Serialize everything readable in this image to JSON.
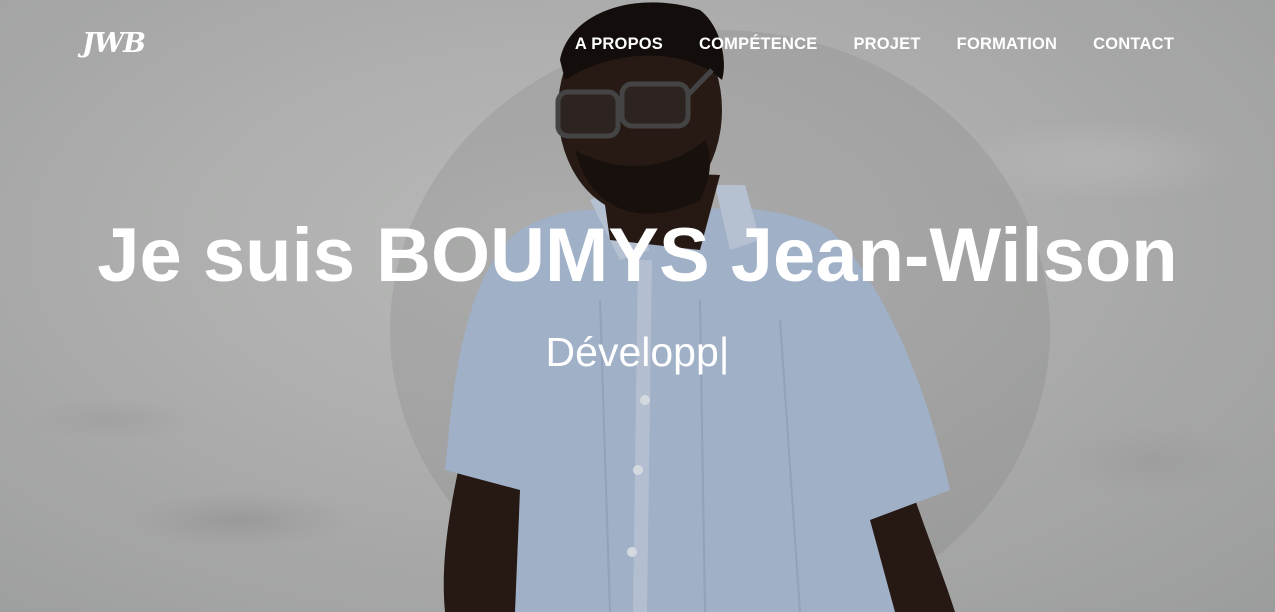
{
  "brand": {
    "logo_text": "JWB"
  },
  "nav": {
    "items": [
      {
        "label": "A PROPOS"
      },
      {
        "label": "COMPÉTENCE"
      },
      {
        "label": "PROJET"
      },
      {
        "label": "FORMATION"
      },
      {
        "label": "CONTACT"
      }
    ]
  },
  "hero": {
    "headline": "Je suis BOUMYS Jean-Wilson",
    "typed_text": "Développ",
    "cursor": "|"
  },
  "colors": {
    "text": "#ffffff",
    "shirt": "#aebfd8",
    "skin": "#2a1c16",
    "wall": "#bfc0bf"
  }
}
